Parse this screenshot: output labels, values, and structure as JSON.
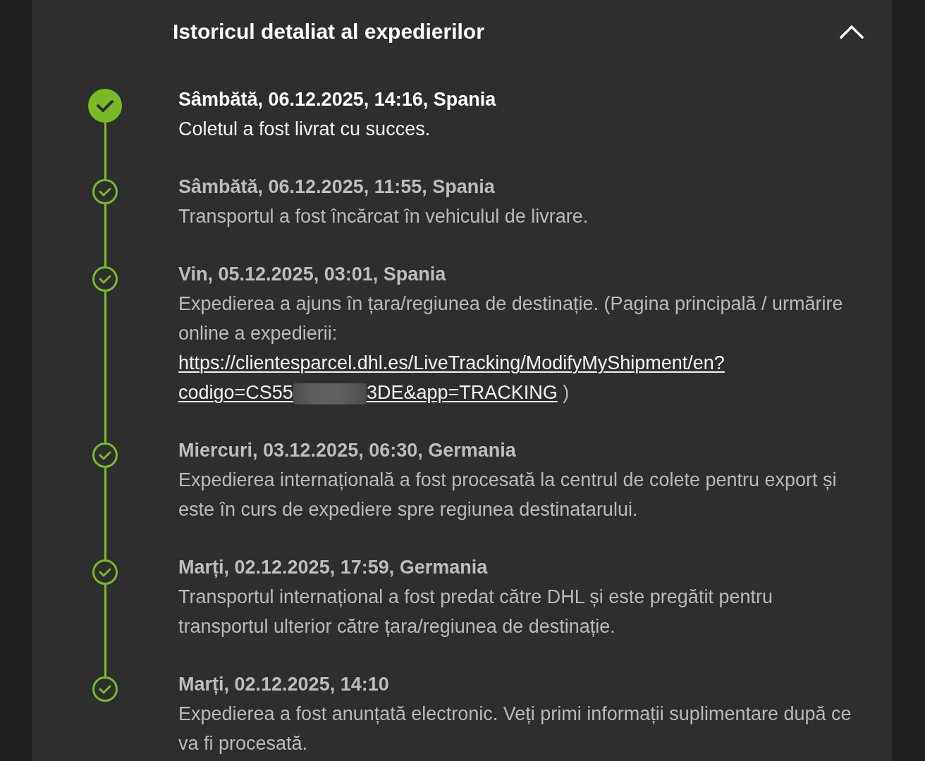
{
  "section": {
    "title": "Istoricul detaliat al expedierilor",
    "expanded": true
  },
  "events": [
    {
      "current": true,
      "heading": "Sâmbătă, 06.12.2025, 14:16, Spania",
      "description": "Coletul a fost livrat cu succes."
    },
    {
      "current": false,
      "heading": "Sâmbătă, 06.12.2025, 11:55, Spania",
      "description": "Transportul a fost încărcat în vehiculul de livrare."
    },
    {
      "current": false,
      "heading": "Vin, 05.12.2025, 03:01, Spania",
      "description": "Expedierea a ajuns în țara/regiunea de destinație. (Pagina principală / urmărire online a expedierii:",
      "link": {
        "line_1": "https://clientesparcel.dhl.es/LiveTracking/ModifyMyShipment/en?",
        "line_2_start": "codigo=CS55",
        "redacted": true,
        "line_2_end": "3DE&app=TRACKING"
      },
      "closing": ")"
    },
    {
      "current": false,
      "heading": "Miercuri, 03.12.2025, 06:30, Germania",
      "description": "Expedierea internațională a fost procesată la centrul de colete pentru export și este în curs de expediere spre regiunea destinatarului."
    },
    {
      "current": false,
      "heading": "Marți, 02.12.2025, 17:59, Germania",
      "description": "Transportul internațional a fost predat către DHL și este pregătit pentru transportul ulterior către țara/regiunea de destinație."
    },
    {
      "current": false,
      "heading": "Marți, 02.12.2025, 14:10",
      "description": "Expedierea a fost anunțată electronic. Veți primi informații suplimentare după ce va fi procesată."
    }
  ]
}
